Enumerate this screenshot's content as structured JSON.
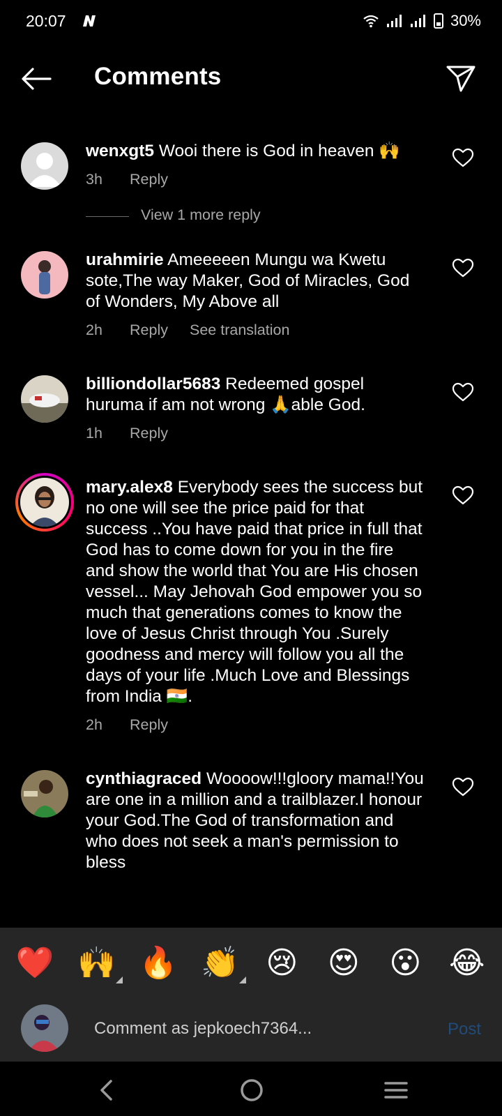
{
  "status": {
    "time": "20:07",
    "battery": "30%"
  },
  "header": {
    "title": "Comments"
  },
  "comments": [
    {
      "username": "wenxgt5",
      "text": "Wooi there is God in heaven 🙌",
      "time": "3h",
      "reply": "Reply"
    },
    {
      "username": "urahmirie",
      "text": "Ameeeeen Mungu wa Kwetu sote,The way Maker, God of Miracles, God of Wonders, My Above all",
      "time": "2h",
      "reply": "Reply",
      "translate": "See translation"
    },
    {
      "username": "billiondollar5683",
      "text": "Redeemed gospel huruma if am not wrong 🙏able God.",
      "time": "1h",
      "reply": "Reply"
    },
    {
      "username": "mary.alex8",
      "text": "Everybody sees the success but no one will see the price paid for that success ..You have paid that price in full that God has to come down for you in the fire and show the world that You are His chosen vessel... May Jehovah God empower you so much that generations comes to know the love of Jesus Christ through You .Surely goodness and mercy will follow you all the days of your life .Much Love and Blessings from India 🇮🇳.",
      "time": "2h",
      "reply": "Reply"
    },
    {
      "username": "cynthiagraced",
      "text": "Woooow!!!gloory mama!!You are one in a million and a trailblazer.I honour your God.The God of transformation and who does not seek a man's permission to bless"
    }
  ],
  "view_more": "View 1 more reply",
  "emojis": [
    "❤️",
    "🙌",
    "🔥",
    "👏",
    "😢",
    "😍",
    "😮",
    "😂"
  ],
  "compose": {
    "placeholder": "Comment as jepkoech7364...",
    "post": "Post"
  },
  "colors": {
    "background": "#000000",
    "secondary_text": "#a8a8a8",
    "bar": "#262626",
    "post_disabled": "#1f4c7a"
  }
}
